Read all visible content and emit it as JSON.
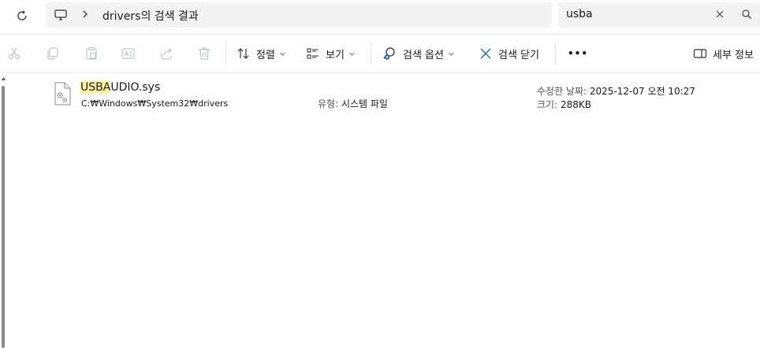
{
  "address": {
    "breadcrumb": "drivers의 검색 결과"
  },
  "search": {
    "value": "usba"
  },
  "toolbar": {
    "sort": "정렬",
    "view": "보기",
    "search_options": "검색 옵션",
    "close_search": "검색 닫기",
    "more": "•••",
    "details": "세부 정보"
  },
  "results": [
    {
      "name_highlight": "USBA",
      "name_rest": "UDIO.sys",
      "path": "C:₩Windows₩System32₩drivers",
      "type_label": "유형:",
      "type_value": "시스템 파일",
      "modified_label": "수정한 날짜:",
      "modified_value": "2025-12-07 오전 10:27",
      "size_label": "크기:",
      "size_value": "288KB"
    }
  ]
}
